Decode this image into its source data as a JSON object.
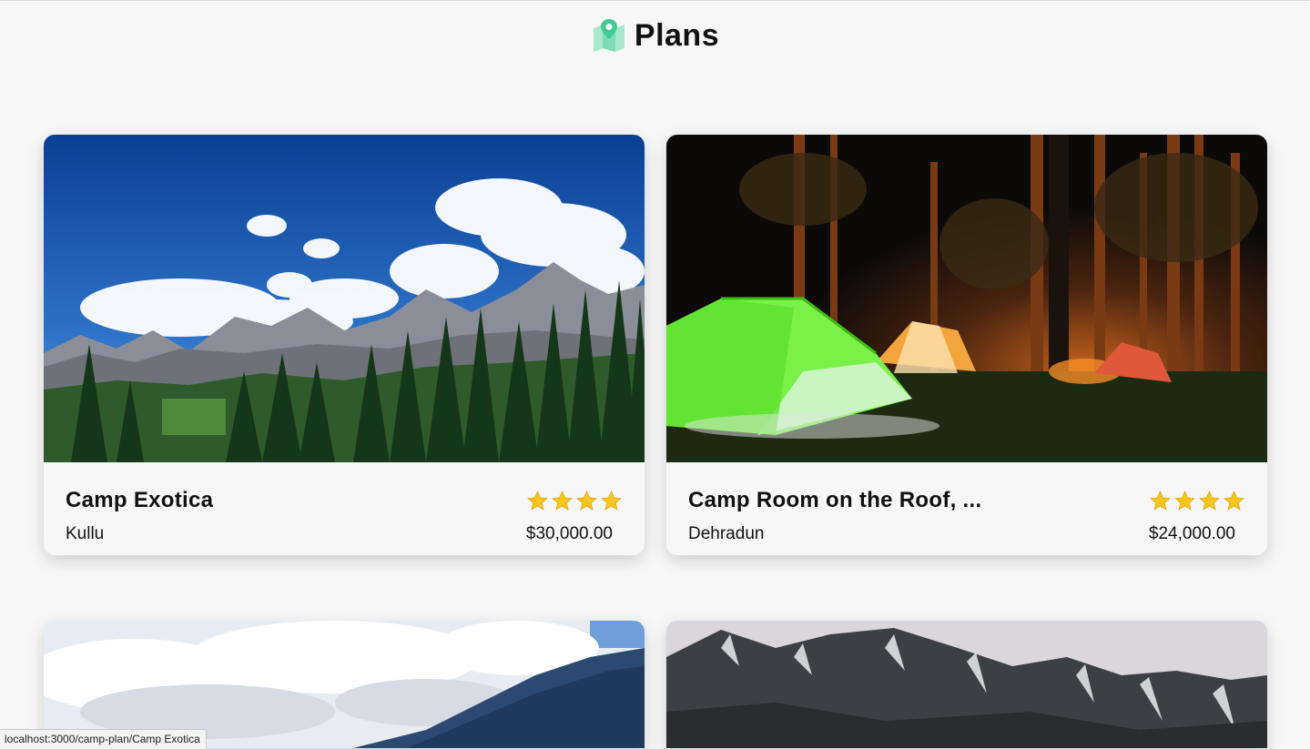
{
  "header": {
    "title": "Plans",
    "logo_icon": "map-pin-icon",
    "logo_color": "#4fd1a0"
  },
  "cards": [
    {
      "name": "Camp Exotica",
      "location": "Kullu",
      "price": "$30,000.00",
      "rating": 4,
      "image": "mountains-forest"
    },
    {
      "name": "Camp Room on the Roof, ...",
      "location": "Dehradun",
      "price": "$24,000.00",
      "rating": 4,
      "image": "tents-night-forest"
    },
    {
      "image": "forest-hill-clouds"
    },
    {
      "image": "snowy-mountains"
    }
  ],
  "status_bar": {
    "url": "localhost:3000/camp-plan/Camp Exotica"
  },
  "colors": {
    "background": "#f7f7f7",
    "star": "#f7c51e"
  }
}
